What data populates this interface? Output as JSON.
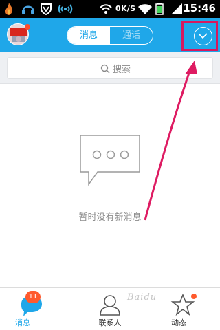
{
  "status_bar": {
    "speed": "0K/S",
    "time": "15:46",
    "icons": [
      "flame-icon",
      "headset-icon",
      "shield-icon",
      "wifi-signal-icon",
      "wifi-icon",
      "battery-icon",
      "signal-bars-icon",
      "wifi-hotspot-icon"
    ]
  },
  "header": {
    "tabs": [
      {
        "label": "消息",
        "active": true
      },
      {
        "label": "通话",
        "active": false
      }
    ],
    "accent_color": "#1fa7e9",
    "highlight_color": "#d6195f"
  },
  "search": {
    "placeholder": "搜索"
  },
  "empty_state": {
    "message": "暂时没有新消息"
  },
  "bottom_nav": {
    "items": [
      {
        "label": "消息",
        "badge": "11",
        "active": true
      },
      {
        "label": "联系人",
        "active": false
      },
      {
        "label": "动态",
        "active": false,
        "dot": true
      }
    ]
  },
  "watermark": "Baidu"
}
